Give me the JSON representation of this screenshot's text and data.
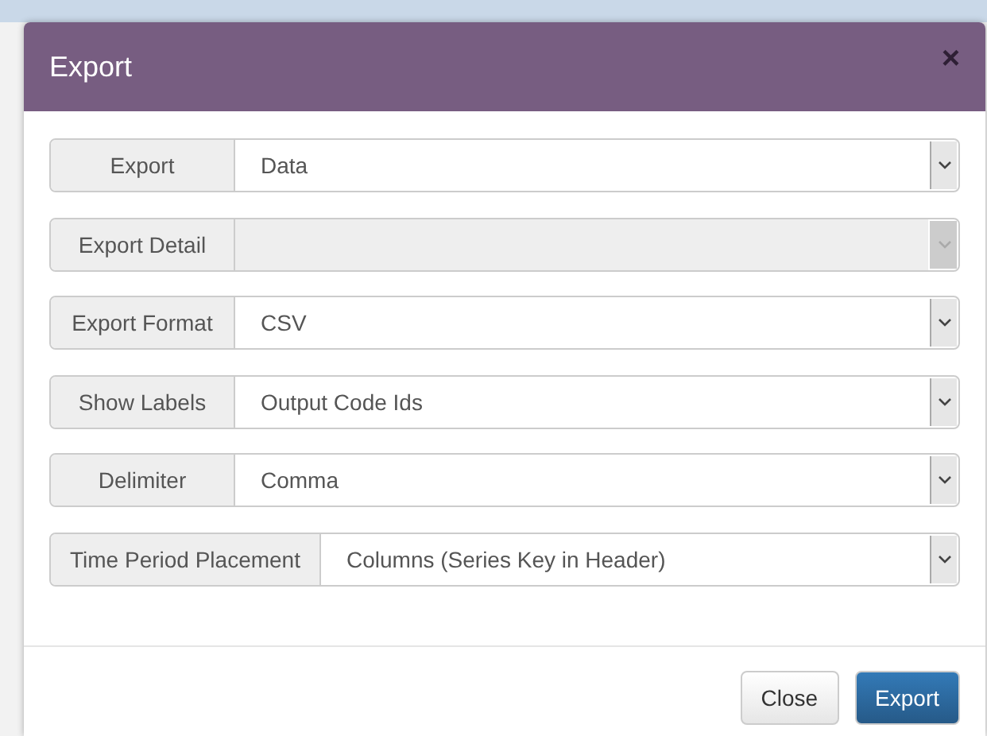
{
  "dialog": {
    "title": "Export",
    "close": "×"
  },
  "fields": [
    {
      "label": "Export",
      "value": "Data",
      "disabled": false
    },
    {
      "label": "Export Detail",
      "disabled": true
    },
    {
      "label": "Export Format",
      "value": "CSV",
      "disabled": false
    },
    {
      "label": "Show Labels",
      "value": "Output Code Ids",
      "disabled": false
    },
    {
      "label": "Delimiter",
      "value": "Comma",
      "disabled": false
    },
    {
      "label": "Time Period Placement",
      "value": "Columns (Series Key in Header)",
      "disabled": false
    }
  ],
  "buttons": [
    {
      "label": "Close",
      "kind": "default"
    },
    {
      "label": "Export",
      "kind": "primary"
    }
  ]
}
